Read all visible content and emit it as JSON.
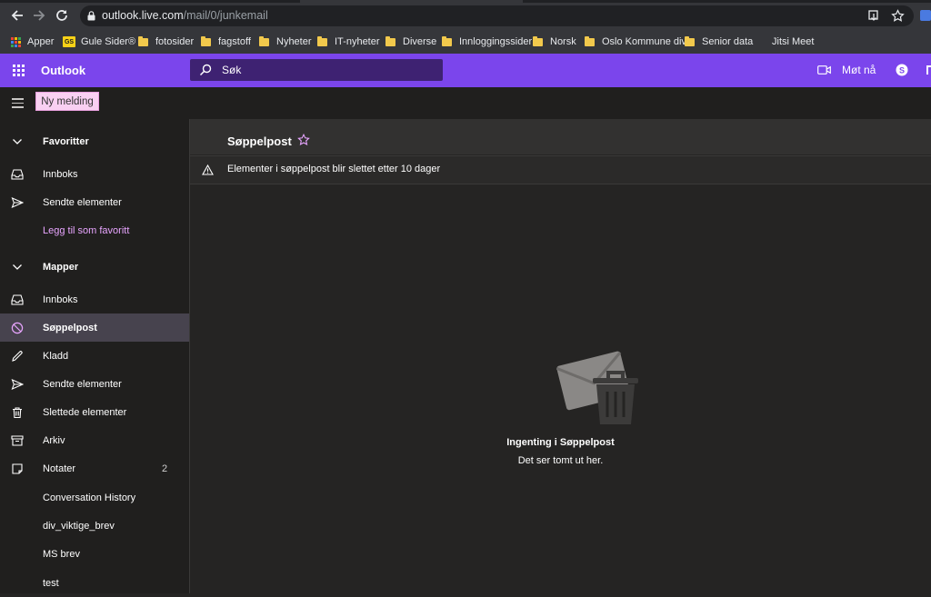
{
  "browser": {
    "url_host": "outlook.live.com",
    "url_path": "/mail/0/junkemail",
    "bookmarks": [
      {
        "label": "Apper",
        "icon": "apps-grid-icon"
      },
      {
        "label": "Gule Sider®",
        "icon": "gule-sider-logo"
      },
      {
        "label": "fotosider",
        "icon": "folder-icon"
      },
      {
        "label": "fagstoff",
        "icon": "folder-icon"
      },
      {
        "label": "Nyheter",
        "icon": "folder-icon"
      },
      {
        "label": "IT-nyheter",
        "icon": "folder-icon"
      },
      {
        "label": "Diverse",
        "icon": "folder-icon"
      },
      {
        "label": "Innloggingssider",
        "icon": "folder-icon"
      },
      {
        "label": "Norsk",
        "icon": "folder-icon"
      },
      {
        "label": "Oslo Kommune div",
        "icon": "folder-icon"
      },
      {
        "label": "Senior data",
        "icon": "folder-icon"
      },
      {
        "label": "Jitsi Meet",
        "icon": "none"
      }
    ]
  },
  "header": {
    "brand": "Outlook",
    "search_placeholder": "Søk",
    "meet_now": "Møt nå",
    "accent": "#7b45ec"
  },
  "command_bar": {
    "new_message": "Ny melding"
  },
  "sidebar": {
    "favorites_header": "Favoritter",
    "favorites": [
      {
        "label": "Innboks",
        "icon": "inbox-icon"
      },
      {
        "label": "Sendte elementer",
        "icon": "send-icon"
      }
    ],
    "add_favorite": "Legg til som favoritt",
    "folders_header": "Mapper",
    "folders": [
      {
        "label": "Innboks",
        "icon": "inbox-icon",
        "count": ""
      },
      {
        "label": "Søppelpost",
        "icon": "blocked-icon",
        "count": "",
        "selected": true
      },
      {
        "label": "Kladd",
        "icon": "pencil-icon",
        "count": ""
      },
      {
        "label": "Sendte elementer",
        "icon": "send-icon",
        "count": ""
      },
      {
        "label": "Slettede elementer",
        "icon": "trash-icon",
        "count": ""
      },
      {
        "label": "Arkiv",
        "icon": "archive-icon",
        "count": ""
      },
      {
        "label": "Notater",
        "icon": "note-icon",
        "count": "2"
      },
      {
        "label": "Conversation History",
        "icon": "none",
        "count": ""
      },
      {
        "label": "div_viktige_brev",
        "icon": "none",
        "count": ""
      },
      {
        "label": "MS brev",
        "icon": "none",
        "count": ""
      },
      {
        "label": "test",
        "icon": "none",
        "count": ""
      }
    ]
  },
  "main": {
    "folder_title": "Søppelpost",
    "notice": "Elementer i søppelpost blir slettet etter 10 dager",
    "empty_title": "Ingenting i Søppelpost",
    "empty_subtitle": "Det ser tomt ut her."
  }
}
